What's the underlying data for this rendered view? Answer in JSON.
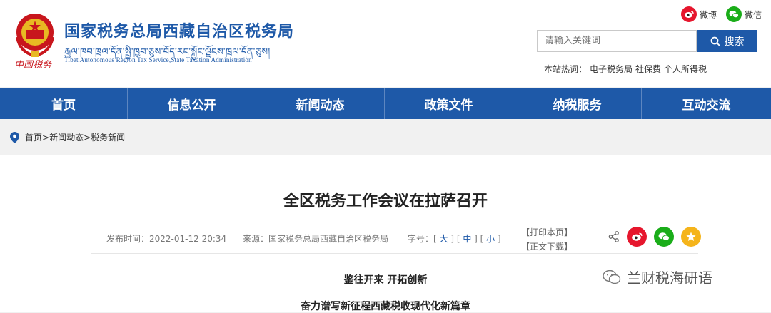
{
  "header": {
    "calligraphy": "中国税务",
    "site_title": "国家税务总局西藏自治区税务局",
    "tibetan_title": "རྒྱལ་ཁབ་ཁྲལ་དོན་སྤྱི་ཁྱབ་ཅུས་བོད་རང་སྐྱོང་ལྗོངས་ཁྲལ་དོན་ཅུས།",
    "english_title": "Tibet Autonomous Region Tax Service,State Taxation Administration",
    "weibo_label": "微博",
    "wechat_label": "微信",
    "search_placeholder": "请输入关键词",
    "search_button": "搜索",
    "hotwords_label": "本站热词：",
    "hotwords": [
      "电子税务局",
      "社保费",
      "个人所得税"
    ]
  },
  "nav": {
    "items": [
      "首页",
      "信息公开",
      "新闻动态",
      "政策文件",
      "纳税服务",
      "互动交流"
    ]
  },
  "breadcrumb": {
    "items": [
      "首页",
      "新闻动态",
      "税务新闻"
    ],
    "separator": ">"
  },
  "article": {
    "title": "全区税务工作会议在拉萨召开",
    "publish_label": "发布时间：",
    "publish_time": "2022-01-12 20:34",
    "source_label": "来源：",
    "source": "国家税务总局西藏自治区税务局",
    "font_label": "字号：",
    "font_large": "大",
    "font_medium": "中",
    "font_small": "小",
    "print_label": "【打印本页】",
    "download_label": "【正文下载】",
    "subheading_1": "鉴往开来  开拓创新",
    "subheading_2": "奋力谱写新征程西藏税收现代化新篇章"
  },
  "watermark": {
    "text": "兰财税海研语"
  },
  "colors": {
    "brand_blue": "#1e59a8",
    "weibo_red": "#e6162d",
    "wechat_green": "#1aad19",
    "star_gold": "#f5b41b",
    "emblem_red": "#c8161d"
  }
}
